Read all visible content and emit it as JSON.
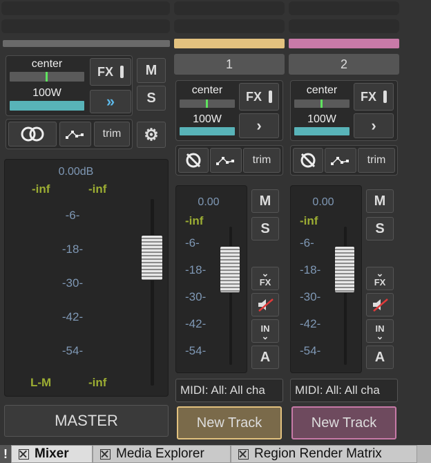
{
  "master": {
    "pan_label": "center",
    "pan_position": 0.5,
    "width_label": "100W",
    "width_fill": 1.0,
    "fx_label": "FX",
    "mute_label": "M",
    "solo_label": "S",
    "trim_label": "trim",
    "peak_db": "0.00dB",
    "peak_left": "-inf",
    "peak_right": "-inf",
    "scale": [
      "-6-",
      "-18-",
      "-30-",
      "-42-",
      "-54-"
    ],
    "mode_label": "L-M",
    "mode_value": "-inf",
    "name": "MASTER"
  },
  "tracks": [
    {
      "number": "1",
      "color": "#e3c27f",
      "pan_label": "center",
      "width_label": "100W",
      "fx_label": "FX",
      "trim_label": "trim",
      "volume": "0.00",
      "peak": "-inf",
      "scale": [
        "-6-",
        "-18-",
        "-30-",
        "-42-",
        "-54-"
      ],
      "mute_label": "M",
      "solo_label": "S",
      "fx_small": "FX",
      "input_small": "IN",
      "automation_label": "A",
      "midi_label": "MIDI: All: All cha",
      "name": "New Track",
      "name_bg": "#7a6a4a"
    },
    {
      "number": "2",
      "color": "#c87aa8",
      "pan_label": "center",
      "width_label": "100W",
      "fx_label": "FX",
      "trim_label": "trim",
      "volume": "0.00",
      "peak": "-inf",
      "scale": [
        "-6-",
        "-18-",
        "-30-",
        "-42-",
        "-54-"
      ],
      "mute_label": "M",
      "solo_label": "S",
      "fx_small": "FX",
      "input_small": "IN",
      "automation_label": "A",
      "midi_label": "MIDI: All: All cha",
      "name": "New Track",
      "name_bg": "#6e4a5e"
    }
  ],
  "tabs": [
    {
      "label": "Mixer",
      "active": true
    },
    {
      "label": "Media Explorer",
      "active": false
    },
    {
      "label": "Region Render Matrix",
      "active": false
    }
  ],
  "accent": "#58b3b8"
}
